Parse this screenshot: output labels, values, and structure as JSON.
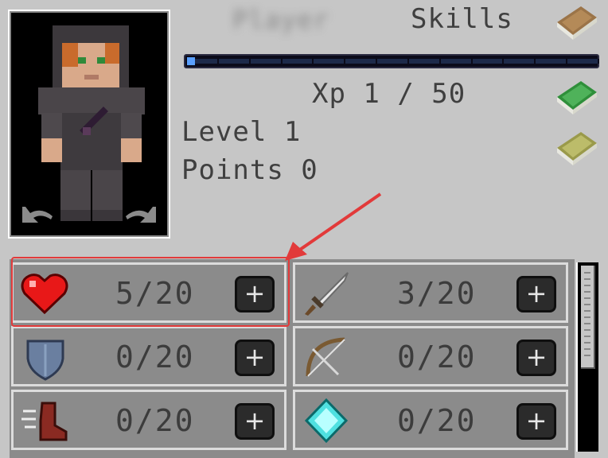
{
  "header": {
    "title": "Skills",
    "xp_text": "Xp 1 / 50",
    "level_text": "Level 1",
    "points_text": "Points 0",
    "player_name": "Player"
  },
  "xp": {
    "current": 1,
    "max": 50
  },
  "icons": {
    "books": [
      "skills-book-icon",
      "green-book-icon",
      "olive-book-icon"
    ],
    "rotate": [
      "rotate-left-icon",
      "rotate-right-icon"
    ]
  },
  "skills": [
    {
      "id": "health",
      "icon": "heart-icon",
      "value": "5/20"
    },
    {
      "id": "attack",
      "icon": "sword-icon",
      "value": "3/20"
    },
    {
      "id": "defense",
      "icon": "shield-icon",
      "value": "0/20"
    },
    {
      "id": "archery",
      "icon": "bow-icon",
      "value": "0/20"
    },
    {
      "id": "speed",
      "icon": "boot-icon",
      "value": "0/20"
    },
    {
      "id": "magic",
      "icon": "diamond-icon",
      "value": "0/20"
    }
  ],
  "add_label": "+",
  "colors": {
    "background": "#c6c6c6",
    "slot": "#8b8b8b",
    "highlight": "#e23a3a",
    "xp_fill": "#5aa0ff"
  }
}
